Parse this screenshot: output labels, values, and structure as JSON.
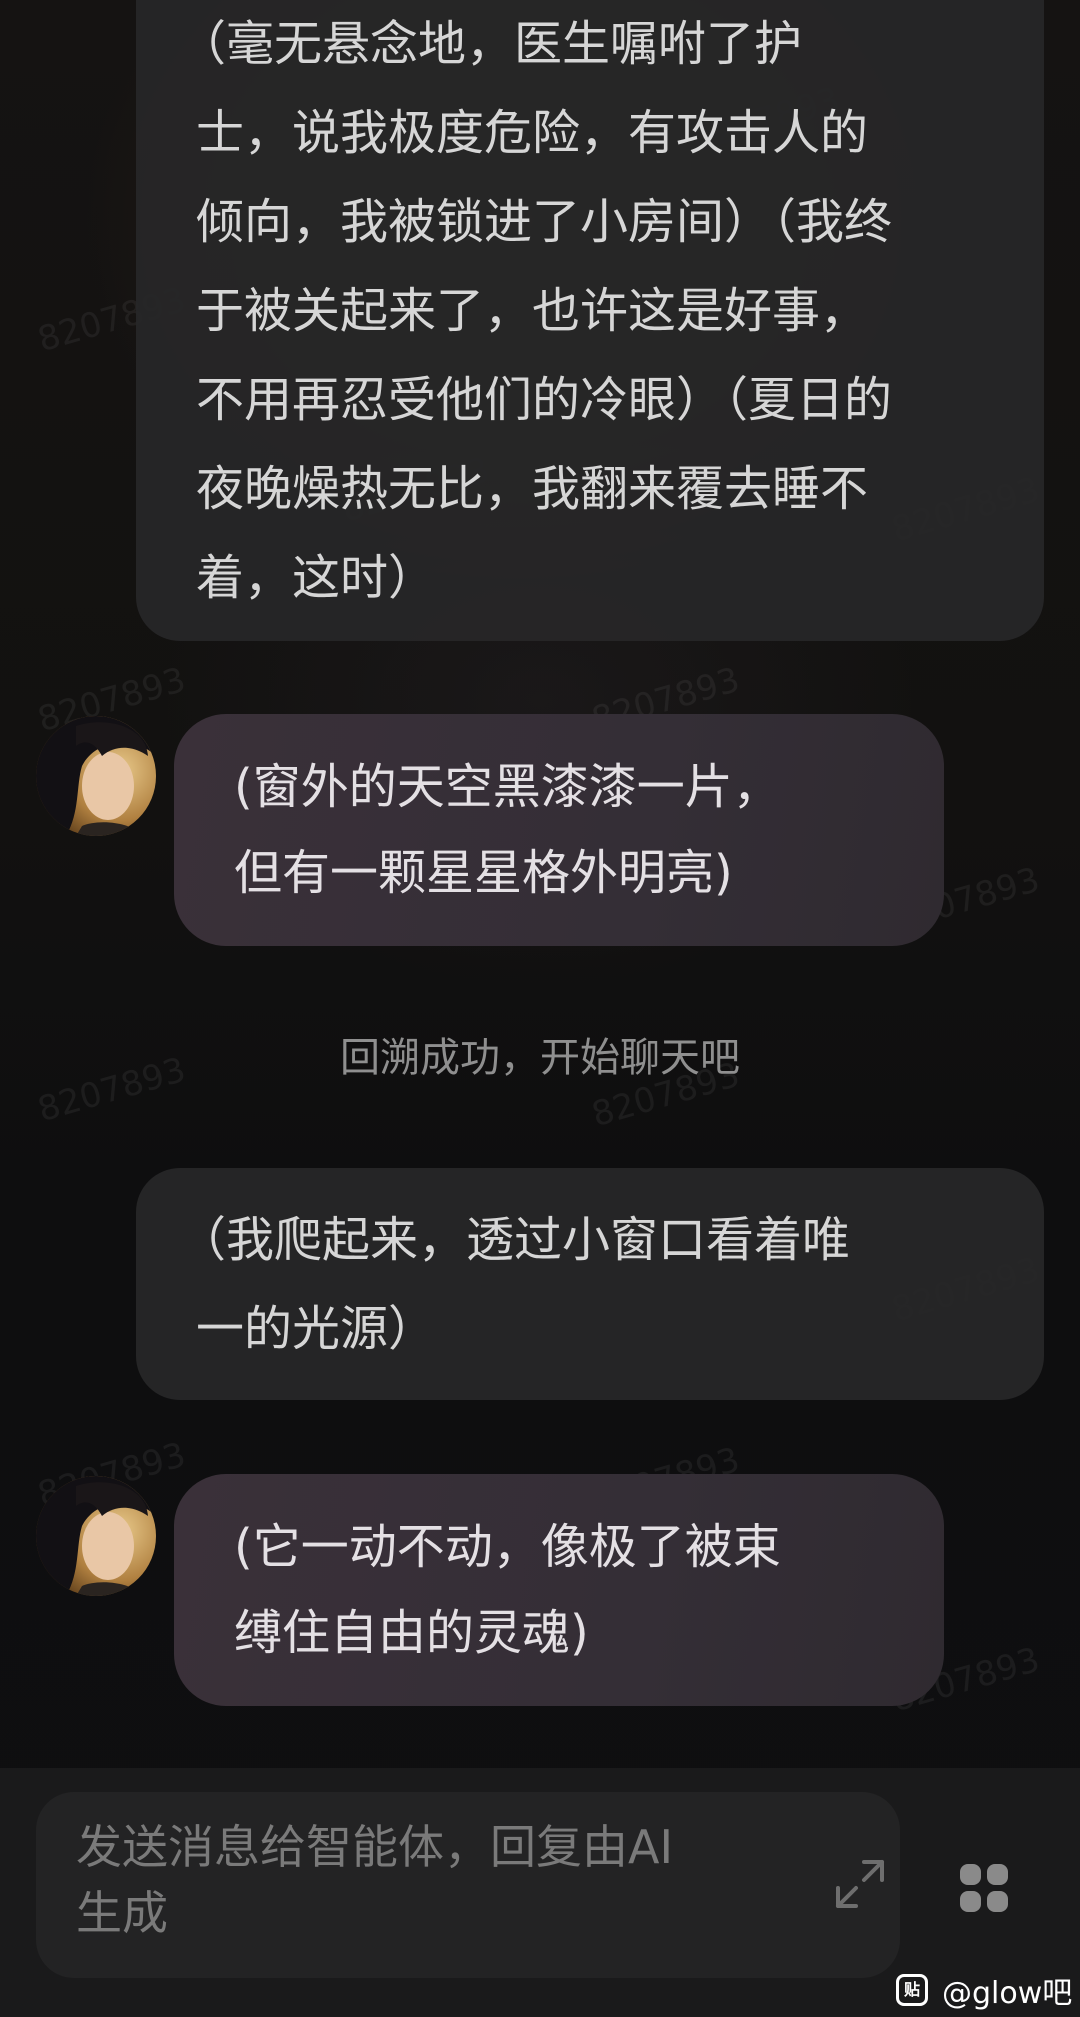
{
  "messages": [
    {
      "role": "user",
      "lines": [
        "（毫无悬念地，医生嘱咐了护",
        "士，说我极度危险，有攻击人的",
        "倾向，我被锁进了小房间）（我终",
        "于被关起来了，也许这是好事，",
        "不用再忍受他们的冷眼）（夏日的",
        "夜晚燥热无比，我翻来覆去睡不",
        "着，这时）"
      ]
    },
    {
      "role": "ai",
      "lines": [
        "(窗外的天空黑漆漆一片，",
        "但有一颗星星格外明亮)"
      ]
    },
    {
      "role": "user",
      "lines": [
        "（我爬起来，透过小窗口看着唯",
        "一的光源）"
      ]
    },
    {
      "role": "ai",
      "lines": [
        "(它一动不动，像极了被束",
        "缚住自由的灵魂)"
      ]
    }
  ],
  "system_note": "回溯成功，开始聊天吧",
  "composer": {
    "placeholder_line1": "发送消息给智能体，回复由AI",
    "placeholder_line2": "生成",
    "expand_icon": "expand-icon",
    "apps_icon": "grid-icon"
  },
  "watermark_text": "8207893",
  "source_badge": {
    "icon_text": "贴",
    "label": "@glow吧"
  }
}
